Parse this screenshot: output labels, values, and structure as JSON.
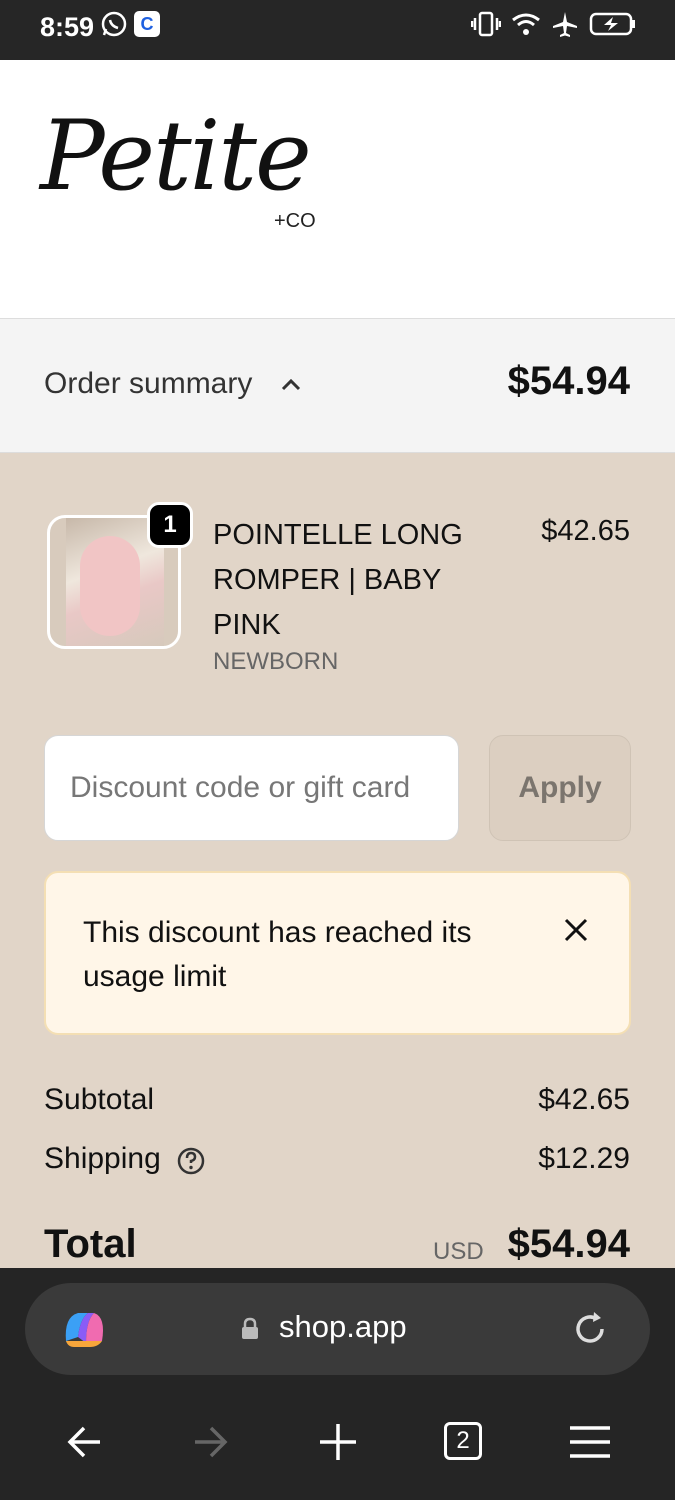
{
  "status_bar": {
    "time": "8:59"
  },
  "brand": {
    "logo_script": "Petite",
    "logo_suffix": "+CO"
  },
  "summary": {
    "label": "Order summary",
    "total": "$54.94"
  },
  "product": {
    "quantity": "1",
    "name": "POINTELLE LONG ROMPER | BABY PINK",
    "variant": "NEWBORN",
    "price": "$42.65"
  },
  "discount": {
    "placeholder": "Discount code or gift card",
    "apply_label": "Apply"
  },
  "alert": {
    "message": "This discount has reached its usage limit"
  },
  "totals": {
    "subtotal_label": "Subtotal",
    "subtotal_value": "$42.65",
    "shipping_label": "Shipping",
    "shipping_value": "$12.29",
    "total_label": "Total",
    "currency": "USD",
    "total_value": "$54.94"
  },
  "browser": {
    "url": "shop.app",
    "tab_count": "2"
  },
  "colors": {
    "beige_bg": "#e1d5c8",
    "alert_bg": "#fff6e8",
    "dark_bar": "#252525"
  }
}
